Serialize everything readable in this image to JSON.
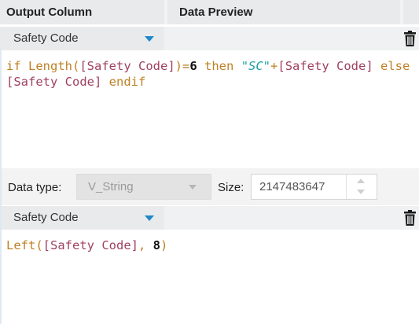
{
  "header": {
    "output_column": "Output Column",
    "data_preview": "Data Preview"
  },
  "rows": [
    {
      "field": "Safety Code",
      "expression": {
        "t1": "if ",
        "t2": "Length",
        "t3": "(",
        "t4": "[Safety Code]",
        "t5": ")=",
        "t6": "6",
        "t7": " then ",
        "t8": "\"SC\"",
        "t9": "+",
        "t10": "[Safety Code]",
        "t11": " else ",
        "t12": "[Safety Code]",
        "t13": " endif"
      }
    },
    {
      "field": "Safety Code",
      "expression": {
        "t1": "Left",
        "t2": "(",
        "t3": "[Safety Code]",
        "t4": ", ",
        "t5": "8",
        "t6": ")"
      }
    }
  ],
  "type_row": {
    "data_type_label": "Data type:",
    "data_type_value": "V_String",
    "size_label": "Size:",
    "size_value": "2147483647"
  },
  "icons": {
    "dropdown": "chevron-down-icon",
    "delete": "trash-icon",
    "spinner_up": "spinner-up-icon",
    "spinner_down": "spinner-down-icon"
  },
  "colors": {
    "accent": "#1e88c8",
    "keyword": "#bd8025",
    "field_ref": "#a04060",
    "string": "#1f9fa0"
  }
}
